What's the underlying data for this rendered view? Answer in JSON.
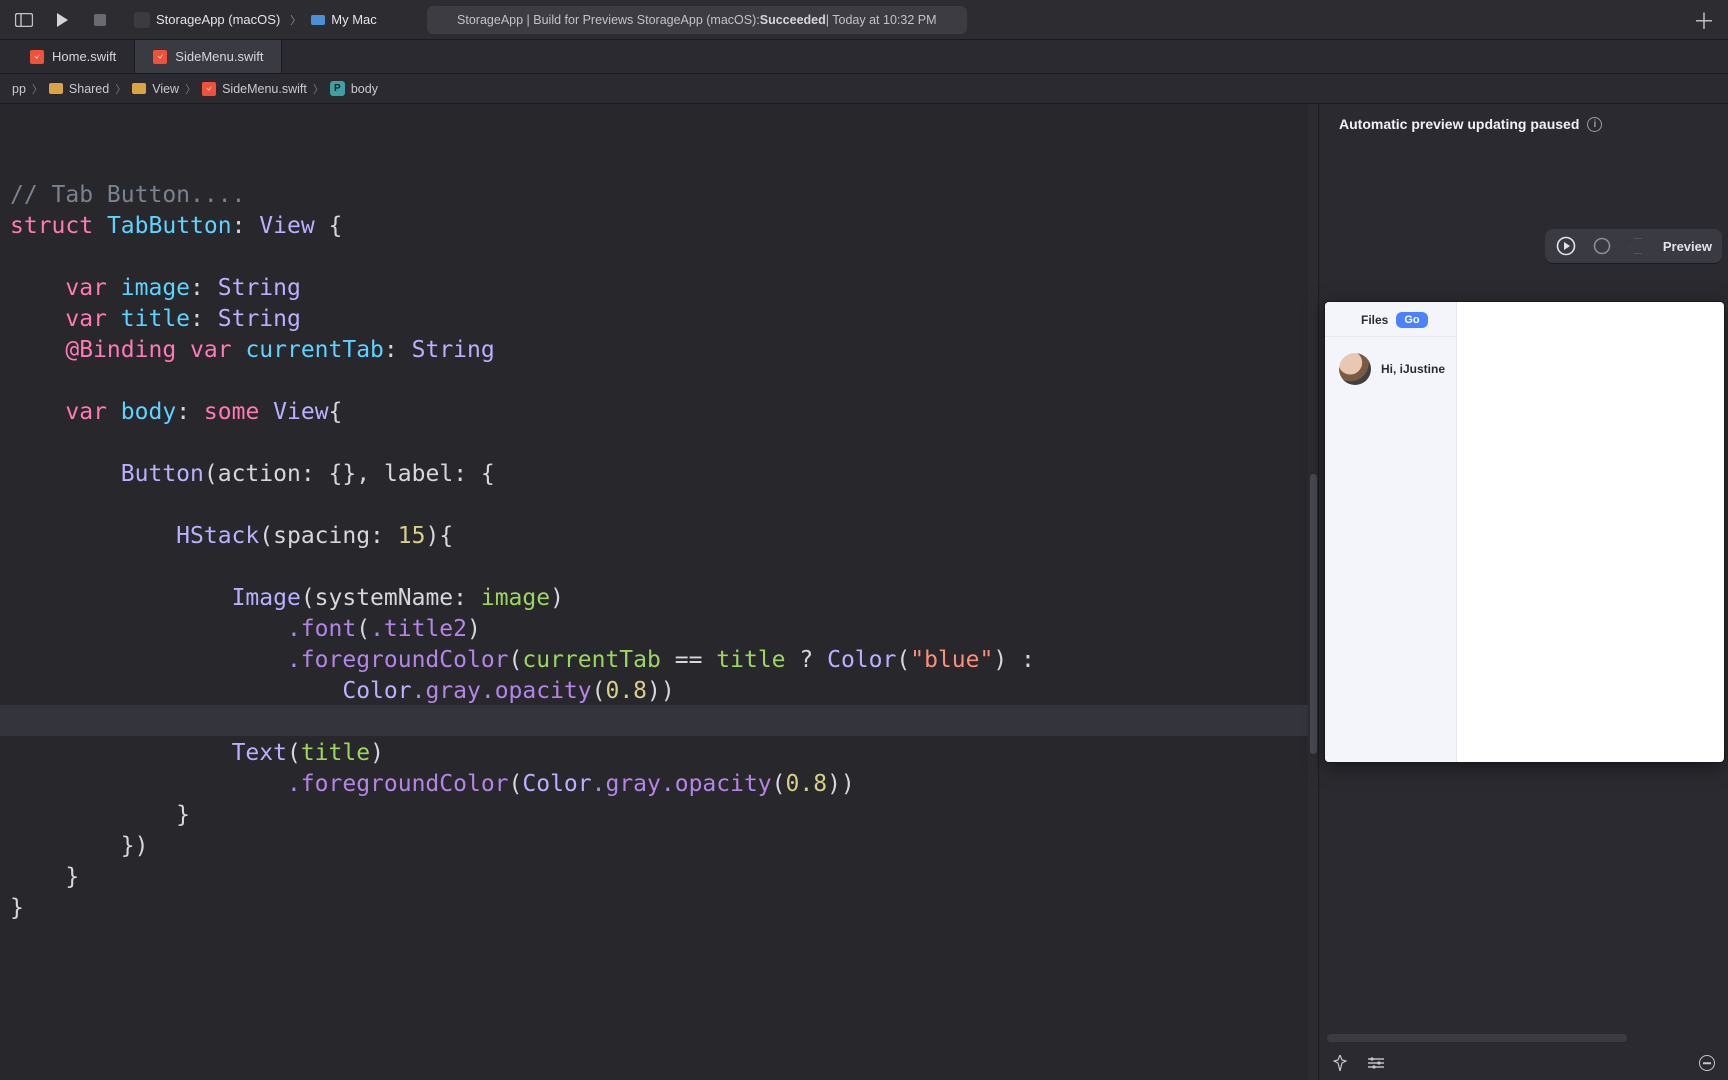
{
  "toolbar": {
    "scheme_app": "StorageApp (macOS)",
    "scheme_device": "My Mac",
    "build_prefix": "StorageApp | Build for Previews StorageApp (macOS): ",
    "build_status": "Succeeded",
    "build_time": " | Today at 10:32 PM"
  },
  "tabs": [
    {
      "label": "Home.swift",
      "active": false
    },
    {
      "label": "SideMenu.swift",
      "active": true
    }
  ],
  "breadcrumbs": {
    "root": "pp",
    "shared": "Shared",
    "view_folder": "View",
    "file": "SideMenu.swift",
    "symbol": "body",
    "symbol_badge": "P"
  },
  "code": {
    "comment": "// Tab Button....",
    "struct_kw": "struct",
    "struct_name": "TabButton",
    "conform": "View",
    "var_kw": "var",
    "prop_image": "image",
    "prop_title": "title",
    "type_string": "String",
    "binding_kw": "@Binding",
    "prop_currentTab": "currentTab",
    "prop_body": "body",
    "some_kw": "some",
    "type_view": "View",
    "button_t": "Button",
    "action_lbl": "action:",
    "label_lbl": "label:",
    "hstack_t": "HStack",
    "spacing_lbl": "spacing:",
    "spacing_v": "15",
    "image_t": "Image",
    "sysname_lbl": "systemName:",
    "font_m": ".font",
    "title2_e": ".title2",
    "fg_m": ".foregroundColor",
    "eq_op": "==",
    "color_t": "Color",
    "blue_str": "\"blue\"",
    "gray_e": ".gray",
    "opacity_m": ".opacity",
    "opacity_v": "0.8",
    "text_t": "Text"
  },
  "preview": {
    "banner": "Automatic preview updating paused",
    "toolbar_label": "Preview",
    "files_label": "Files",
    "go_label": "Go",
    "greeting": "Hi, iJustine"
  }
}
